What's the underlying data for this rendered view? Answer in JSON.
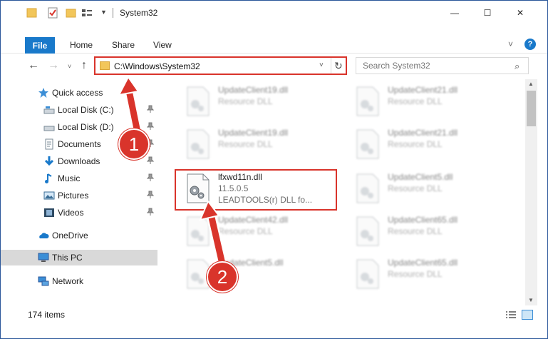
{
  "window": {
    "title": "System32",
    "controls": {
      "minimize": "—",
      "maximize": "☐",
      "close": "✕"
    }
  },
  "ribbon": {
    "tabs": [
      {
        "label": "File",
        "active": true
      },
      {
        "label": "Home"
      },
      {
        "label": "Share"
      },
      {
        "label": "View"
      }
    ],
    "help_icon_text": "?"
  },
  "navigation": {
    "back": "←",
    "forward": "→",
    "recent": "˅",
    "up": "↑",
    "address": "C:\\Windows\\System32",
    "refresh": "↻",
    "search_placeholder": "Search System32"
  },
  "sidebar": {
    "items": [
      {
        "label": "Quick access",
        "icon": "star-icon",
        "pinned": false
      },
      {
        "label": "Local Disk (C:)",
        "icon": "drive-icon",
        "pinned": true
      },
      {
        "label": "Local Disk (D:)",
        "icon": "drive-icon",
        "pinned": true
      },
      {
        "label": "Documents",
        "icon": "documents-icon",
        "pinned": true
      },
      {
        "label": "Downloads",
        "icon": "download-icon",
        "pinned": true
      },
      {
        "label": "Music",
        "icon": "music-icon",
        "pinned": true
      },
      {
        "label": "Pictures",
        "icon": "pictures-icon",
        "pinned": true
      },
      {
        "label": "Videos",
        "icon": "videos-icon",
        "pinned": true
      },
      {
        "label": "OneDrive",
        "icon": "cloud-icon",
        "pinned": false
      },
      {
        "label": "This PC",
        "icon": "computer-icon",
        "pinned": false,
        "selected": true
      },
      {
        "label": "Network",
        "icon": "network-icon",
        "pinned": false
      }
    ]
  },
  "files": [
    {
      "name": "UpdateClient19.dll",
      "line2": "Resource DLL",
      "blurred": true
    },
    {
      "name": "UpdateClient21.dll",
      "line2": "Resource DLL",
      "blurred": true
    },
    {
      "name": "UpdateClient19.dll",
      "line2": "Resource DLL",
      "blurred": true
    },
    {
      "name": "UpdateClient21.dll",
      "line2": "Resource DLL",
      "blurred": true
    },
    {
      "name": "lfxwd11n.dll",
      "line2": "11.5.0.5",
      "line3": "LEADTOOLS(r) DLL fo...",
      "blurred": false,
      "highlighted": true
    },
    {
      "name": "UpdateClient5.dll",
      "line2": "Resource DLL",
      "blurred": true
    },
    {
      "name": "UpdateClient42.dll",
      "line2": "Resource DLL",
      "blurred": true
    },
    {
      "name": "UpdateClient65.dll",
      "line2": "Resource DLL",
      "blurred": true
    },
    {
      "name": "UpdateClient5.dll",
      "line2": "",
      "blurred": true
    },
    {
      "name": "UpdateClient65.dll",
      "line2": "Resource DLL",
      "blurred": true
    }
  ],
  "status": {
    "item_count": "174 items"
  },
  "callouts": [
    {
      "number": "1"
    },
    {
      "number": "2"
    }
  ],
  "colors": {
    "accent": "#1979ca",
    "highlight": "#d9342b",
    "selected_row": "#d9d9d9"
  }
}
